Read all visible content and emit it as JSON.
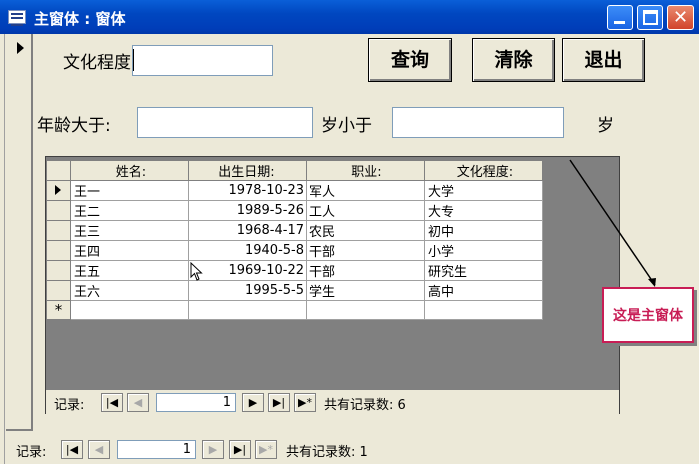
{
  "window": {
    "title": "主窗体 : 窗体",
    "icon": "form-icon"
  },
  "form": {
    "education_label": "文化程度",
    "education_value": "",
    "age_gt_label": "年龄大于:",
    "age_gt_value": "",
    "age_lt_label": "岁小于",
    "age_lt_value": "",
    "age_unit_label": "岁",
    "query_button": "查询",
    "clear_button": "清除",
    "exit_button": "退出"
  },
  "subform": {
    "columns": [
      "姓名:",
      "出生日期:",
      "职业:",
      "文化程度:"
    ],
    "rows": [
      [
        "王一",
        "1978-10-23",
        "军人",
        "大学"
      ],
      [
        "王二",
        "1989-5-26",
        "工人",
        "大专"
      ],
      [
        "王三",
        "1968-4-17",
        "农民",
        "初中"
      ],
      [
        "王四",
        "1940-5-8",
        "干部",
        "小学"
      ],
      [
        "王五",
        "1969-10-22",
        "干部",
        "研究生"
      ],
      [
        "王六",
        "1995-5-5",
        "学生",
        "高中"
      ]
    ],
    "new_record_marker": "*",
    "nav": {
      "label": "记录:",
      "current": "1",
      "total_text": "共有记录数: 6"
    }
  },
  "main_nav": {
    "label": "记录:",
    "current": "1",
    "total_text": "共有记录数: 1"
  },
  "callout": {
    "text": "这是主窗体"
  }
}
